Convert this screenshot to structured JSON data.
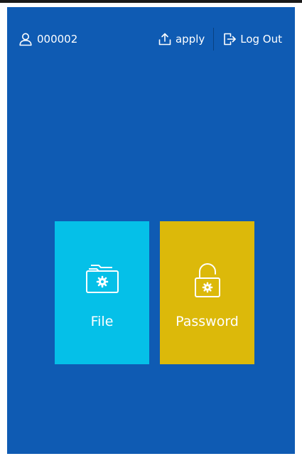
{
  "header": {
    "user_id": "000002",
    "apply_label": "apply",
    "logout_label": "Log Out"
  },
  "tiles": [
    {
      "label": "File",
      "color": "#05c0e8",
      "icon": "folder-gear-icon"
    },
    {
      "label": "Password",
      "color": "#dcb90a",
      "icon": "unlock-gear-icon"
    }
  ],
  "colors": {
    "background": "#0f5bb3",
    "text": "#ffffff"
  }
}
